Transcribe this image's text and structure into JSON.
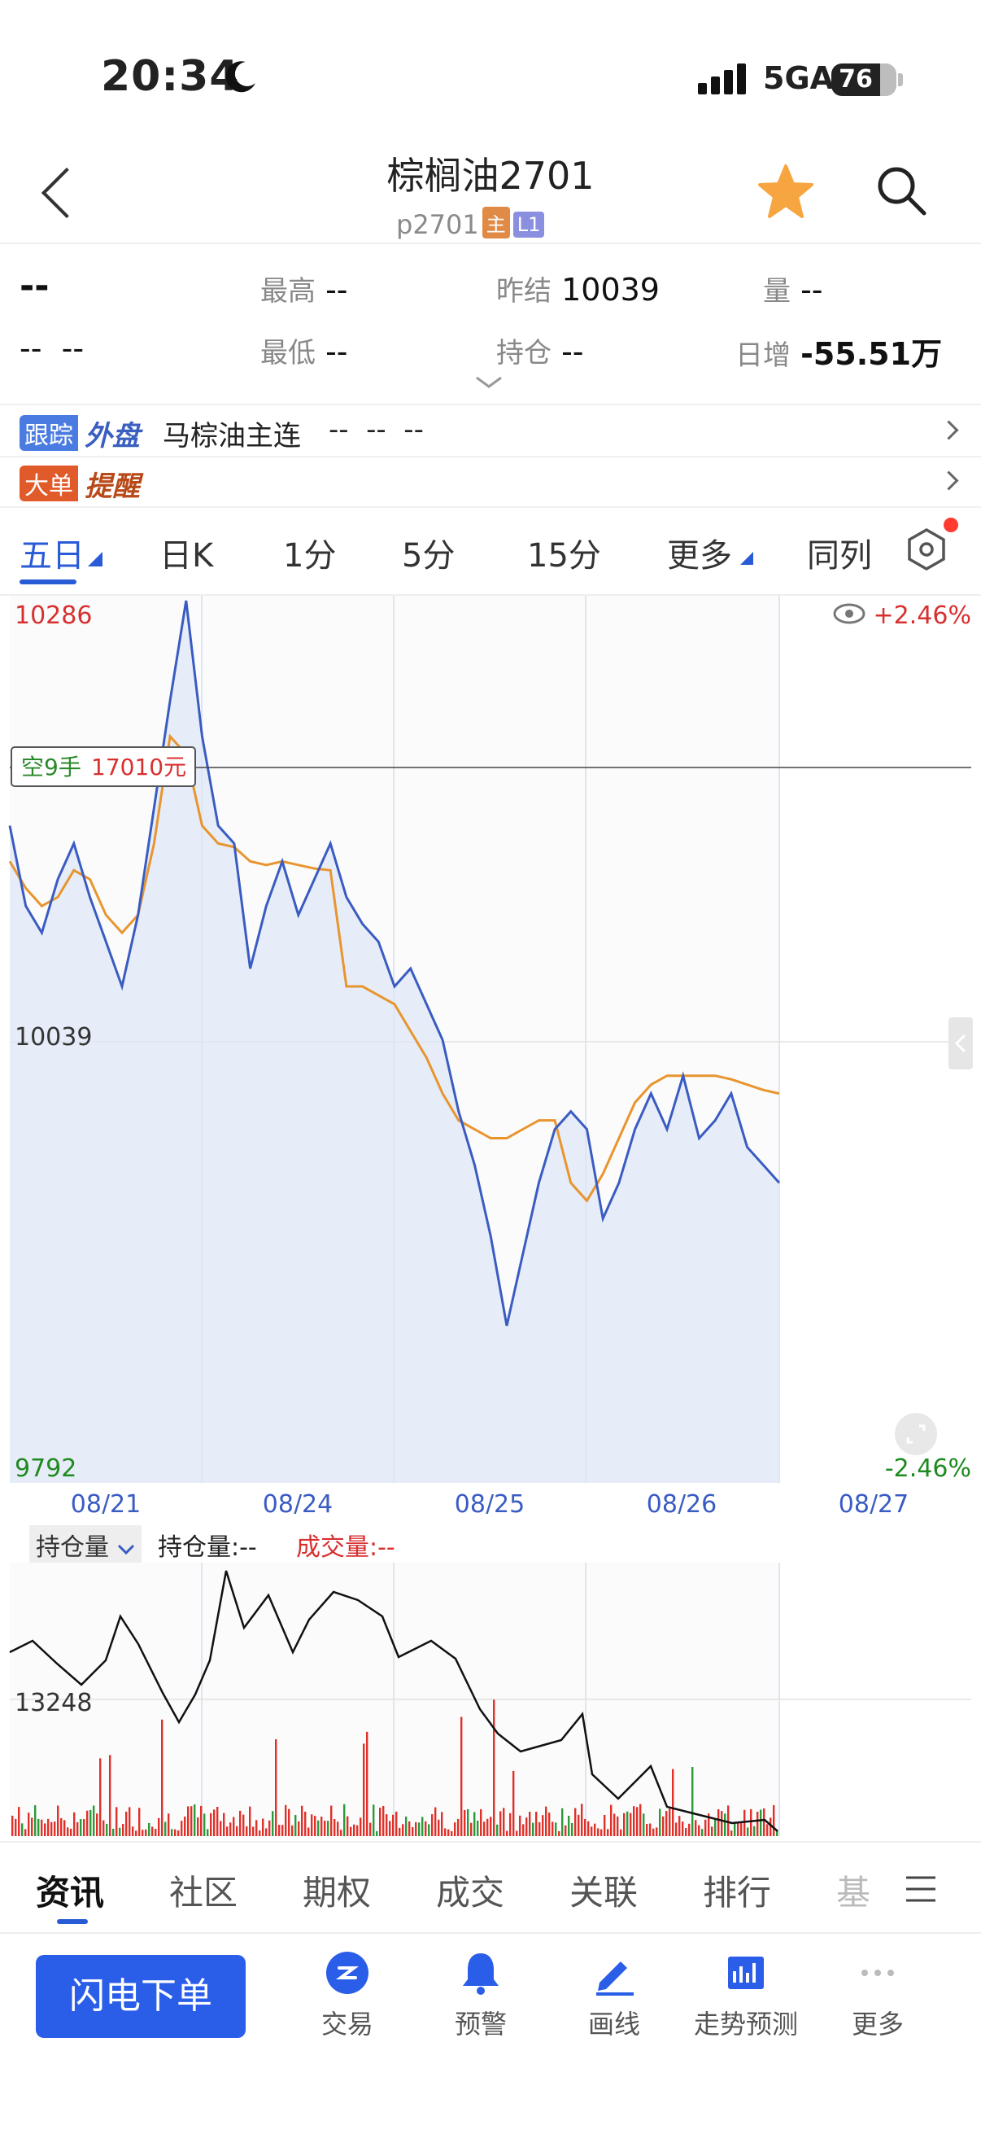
{
  "status_bar": {
    "time": "20:34",
    "network": "5GA",
    "battery": "76"
  },
  "header": {
    "title": "棕榈油2701",
    "code": "p2701",
    "tag_main": "主",
    "tag_level": "L1"
  },
  "quote": {
    "last": "--",
    "change": "--",
    "change_pct": "--",
    "high_label": "最高",
    "high": "--",
    "low_label": "最低",
    "low": "--",
    "prev_settle_label": "昨结",
    "prev_settle": "10039",
    "oi_label": "持仓",
    "oi": "--",
    "vol_label": "量",
    "vol": "--",
    "daily_add_label": "日增",
    "daily_add": "-55.51万"
  },
  "banners": {
    "track_tag": "跟踪",
    "track_tag2": "外盘",
    "track_name": "马棕油主连",
    "track_vals": "--  --  --",
    "big_tag": "大单",
    "big_tag2": "提醒"
  },
  "chart_tabs": [
    "五日",
    "日K",
    "1分",
    "5分",
    "15分",
    "更多",
    "同列"
  ],
  "chart": {
    "y_max": "10286",
    "y_mid": "10039",
    "y_min": "9792",
    "pct_max": "+2.46%",
    "pct_min": "-2.46%",
    "position_label_a": "空9手",
    "position_label_b": "17010元",
    "dates": [
      "08/21",
      "08/24",
      "08/25",
      "08/26",
      "08/27"
    ]
  },
  "sub_chart": {
    "selector": "持仓量",
    "oi_label": "持仓量:--",
    "vol_label": "成交量:--",
    "level": "13248"
  },
  "bottom_tabs": [
    "资讯",
    "社区",
    "期权",
    "成交",
    "关联",
    "排行",
    "基"
  ],
  "toolbar": {
    "flash_order": "闪电下单",
    "items": [
      "交易",
      "预警",
      "画线",
      "走势预测",
      "更多"
    ]
  },
  "chart_data": {
    "type": "line",
    "title": "",
    "ylim": [
      9792,
      10286
    ],
    "x": [
      "08/21",
      "08/24",
      "08/25",
      "08/26"
    ],
    "series": [
      {
        "values": [
          10160,
          10115,
          10100,
          10130,
          10150,
          10120,
          10095,
          10070,
          10110,
          10170,
          10230,
          10286,
          10210,
          10160,
          10150,
          10080,
          10115,
          10140,
          10110,
          10130,
          10150,
          10120,
          10105,
          10095,
          10070,
          10080,
          10060,
          10040,
          10000,
          9970,
          9930,
          9880,
          9920,
          9960,
          9990,
          10000,
          9990,
          9940,
          9960,
          9990,
          10010,
          9990,
          10020,
          9985,
          9995,
          10010,
          9980,
          9970,
          9960
        ]
      },
      {
        "values": [
          10140,
          10125,
          10115,
          10120,
          10135,
          10130,
          10110,
          10100,
          10110,
          10150,
          10210,
          10200,
          10160,
          10150,
          10148,
          10140,
          10138,
          10140,
          10138,
          10136,
          10135,
          10070,
          10070,
          10065,
          10060,
          10045,
          10030,
          10010,
          9995,
          9990,
          9985,
          9985,
          9990,
          9995,
          9995,
          9960,
          9950,
          9965,
          9985,
          10005,
          10015,
          10020,
          10020,
          10020,
          10020,
          10018,
          10015,
          10012,
          10010
        ]
      }
    ]
  }
}
